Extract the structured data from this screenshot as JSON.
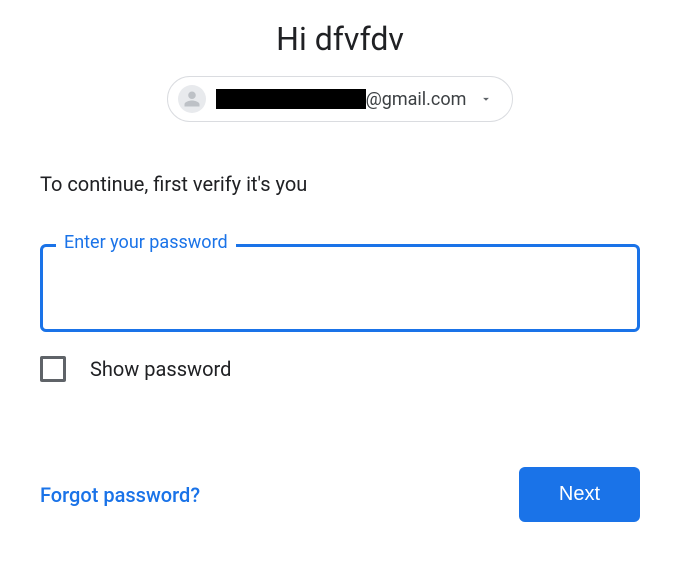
{
  "header": {
    "greeting": "Hi dfvfdv",
    "email_domain": "@gmail.com"
  },
  "body": {
    "subtitle": "To continue, first verify it's you",
    "password_label": "Enter your password",
    "password_value": "",
    "show_password_label": "Show password"
  },
  "footer": {
    "forgot_label": "Forgot password?",
    "next_label": "Next"
  },
  "colors": {
    "primary": "#1a73e8"
  }
}
